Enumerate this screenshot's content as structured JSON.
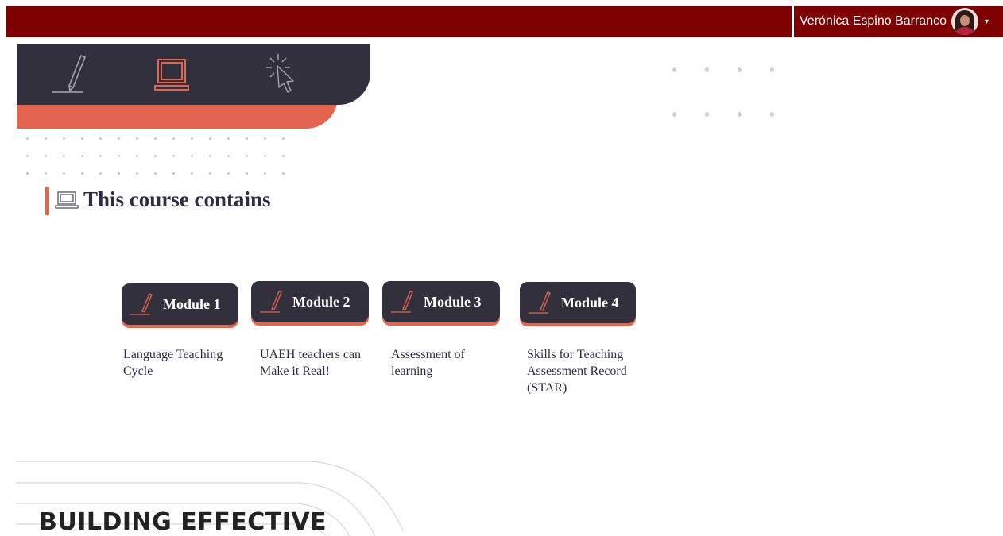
{
  "header": {
    "user_name": "Verónica Espino Barranco",
    "caret": "▾",
    "bar_color": "#7f0000"
  },
  "hero": {
    "icons": [
      "pencil-icon",
      "laptop-icon",
      "cursor-click-icon"
    ],
    "colors": {
      "dark": "#33303e",
      "accent": "#e2654f"
    }
  },
  "course": {
    "heading": "This course contains",
    "modules": [
      {
        "label": "Module 1",
        "description": "Language Teaching Cycle"
      },
      {
        "label": "Module 2",
        "description": "UAEH teachers can Make it Real!"
      },
      {
        "label": "Module 3",
        "description": "Assessment of learning"
      },
      {
        "label": "Module 4",
        "description": "Skills for Teaching Assessment Record (STAR)"
      }
    ]
  },
  "footer": {
    "title": "BUILDING EFFECTIVE"
  }
}
